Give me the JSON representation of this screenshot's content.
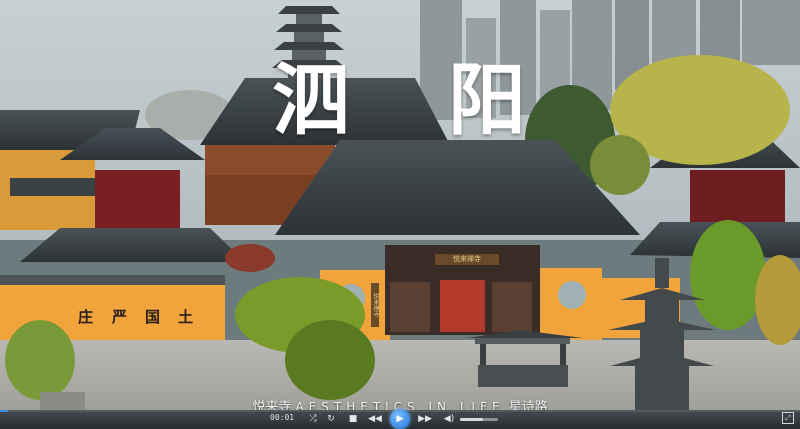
{
  "video": {
    "title_chars": [
      "泗",
      "阳"
    ],
    "subtitle_left": "悦来寺",
    "subtitle_middle": "AESTHETICS IN LIFE",
    "subtitle_right": "星诗路",
    "wall_chars": [
      "庄",
      "严",
      "国",
      "土"
    ],
    "gate_plaque": "悦来禅寺",
    "side_plaque": "悦来禅寺"
  },
  "player": {
    "time": "00:01",
    "progress": 0.01,
    "volume": 0.6,
    "controls": {
      "shuffle_icon": "shuffle-icon",
      "repeat_icon": "repeat-icon",
      "stop_icon": "stop-icon",
      "rewind_icon": "rewind-icon",
      "play_icon": "play-icon",
      "forward_icon": "fast-forward-icon",
      "volume_icon": "volume-icon",
      "fullscreen_icon": "fullscreen-icon"
    },
    "accent_color": "#3d8ee8"
  }
}
